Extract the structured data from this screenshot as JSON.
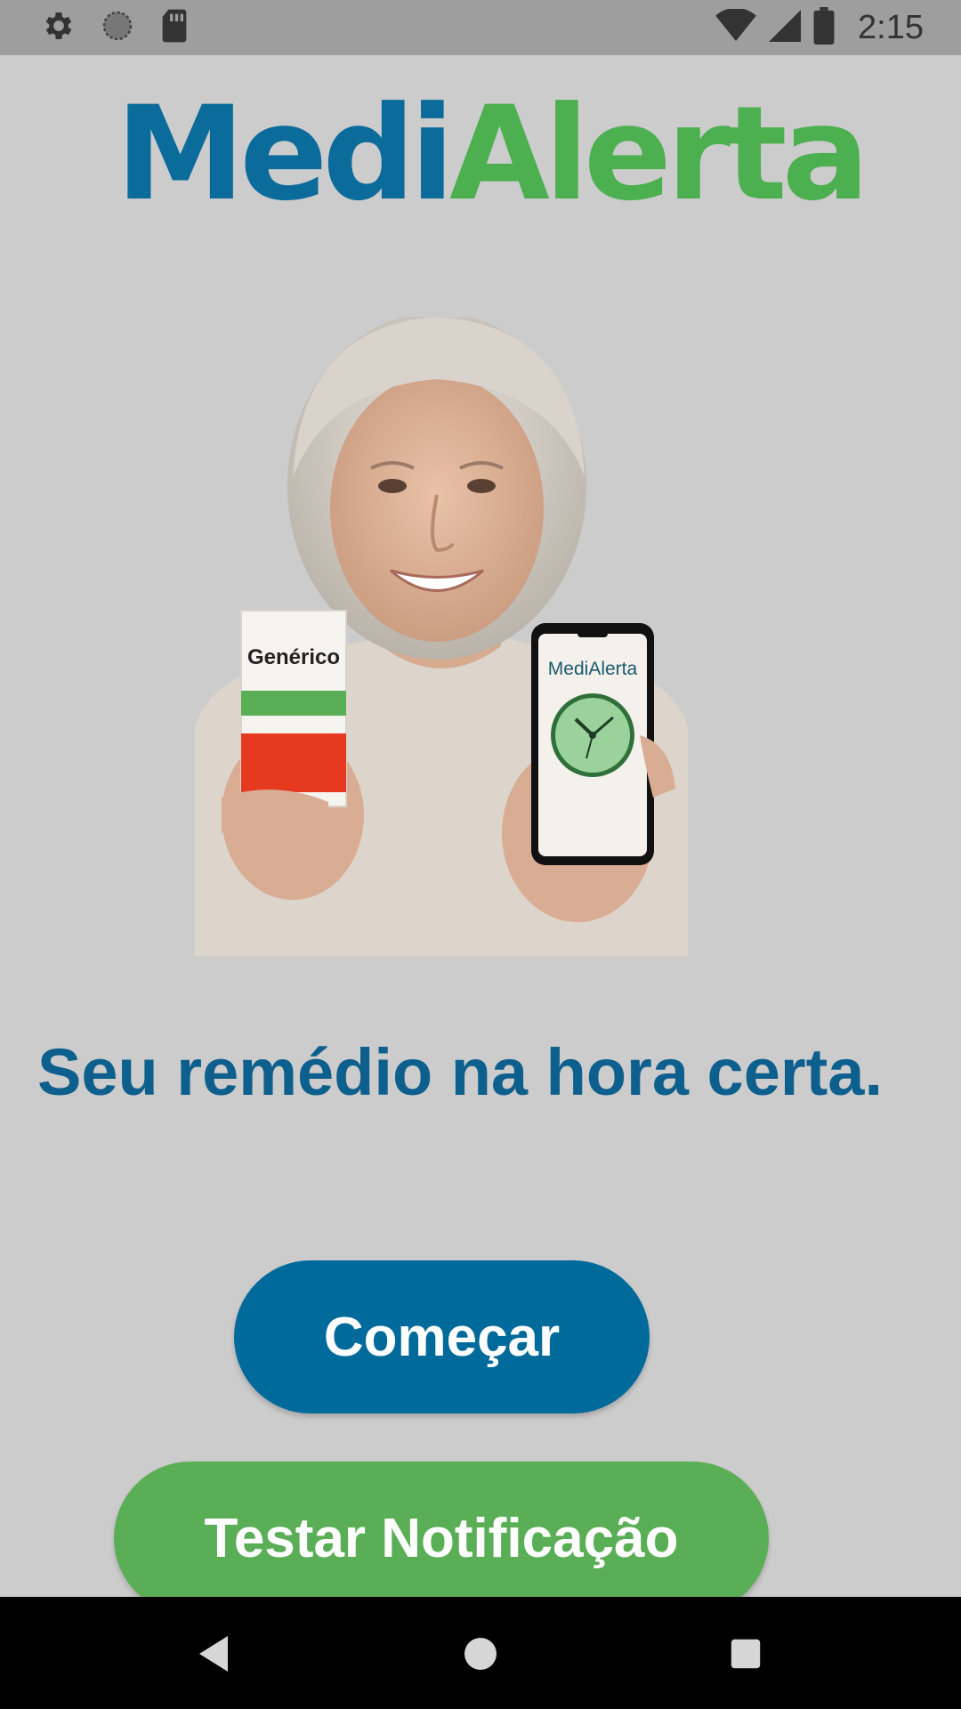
{
  "status_bar": {
    "time": "2:15",
    "left_icons": [
      "gear-icon",
      "circle-sync-icon",
      "sd-card-icon"
    ],
    "right_icons": [
      "wifi-icon",
      "signal-icon",
      "battery-icon"
    ]
  },
  "logo": {
    "part_a": "Medi",
    "part_b": "Alerta",
    "part_a_color": "#0b6b9a",
    "part_b_color": "#4caf50"
  },
  "hero": {
    "box_label": "Genérico",
    "phone_app_name": "MediAlerta"
  },
  "tagline": "Seu remédio na hora certa.",
  "buttons": {
    "start_label": "Começar",
    "start_color": "#006b9b",
    "test_label": "Testar Notificação",
    "test_color": "#5aae56"
  },
  "nav_bar": {
    "icons": [
      "back-icon",
      "home-icon",
      "recents-icon"
    ]
  }
}
